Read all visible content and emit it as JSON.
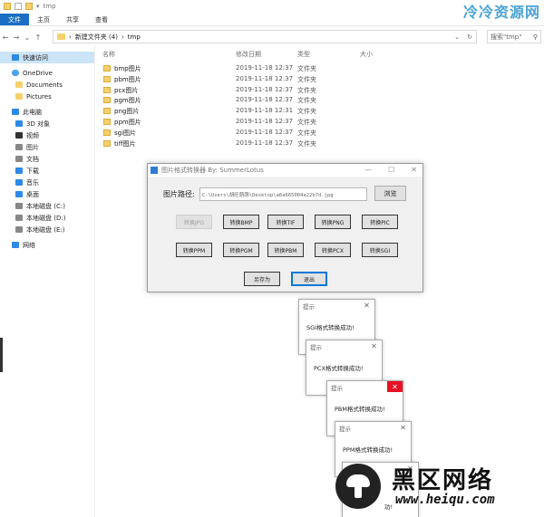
{
  "explorer": {
    "title": "tmp",
    "ribbon_tabs": [
      "文件",
      "主页",
      "共享",
      "查看"
    ],
    "address": [
      "新建文件夹 (4)",
      "tmp"
    ],
    "search_placeholder": "搜索\"tmp\"",
    "sidebar": [
      {
        "label": "快速访问",
        "icon": "star-icon"
      },
      {
        "label": "OneDrive",
        "icon": "cloud-icon"
      },
      {
        "label": "Documents",
        "icon": "folder-icon"
      },
      {
        "label": "Pictures",
        "icon": "folder-icon"
      },
      {
        "label": "此电脑",
        "icon": "computer-icon"
      },
      {
        "label": "3D 对象",
        "icon": "cube-icon"
      },
      {
        "label": "视频",
        "icon": "video-icon"
      },
      {
        "label": "图片",
        "icon": "picture-icon"
      },
      {
        "label": "文档",
        "icon": "document-icon"
      },
      {
        "label": "下载",
        "icon": "download-icon"
      },
      {
        "label": "音乐",
        "icon": "music-icon"
      },
      {
        "label": "桌面",
        "icon": "desktop-icon"
      },
      {
        "label": "本地磁盘 (C:)",
        "icon": "drive-icon"
      },
      {
        "label": "本地磁盘 (D:)",
        "icon": "drive-icon"
      },
      {
        "label": "本地磁盘 (E:)",
        "icon": "drive-icon"
      },
      {
        "label": "网络",
        "icon": "network-icon"
      }
    ],
    "columns": {
      "name": "名称",
      "date": "修改日期",
      "type": "类型",
      "size": "大小"
    },
    "files": [
      {
        "name": "bmp图片",
        "date": "2019-11-18 12:37",
        "type": "文件夹"
      },
      {
        "name": "pbm图片",
        "date": "2019-11-18 12:37",
        "type": "文件夹"
      },
      {
        "name": "pcx图片",
        "date": "2019-11-18 12:37",
        "type": "文件夹"
      },
      {
        "name": "pgm图片",
        "date": "2019-11-18 12:37",
        "type": "文件夹"
      },
      {
        "name": "png图片",
        "date": "2019-11-18 12:31",
        "type": "文件夹"
      },
      {
        "name": "ppm图片",
        "date": "2019-11-18 12:37",
        "type": "文件夹"
      },
      {
        "name": "sgi图片",
        "date": "2019-11-18 12:37",
        "type": "文件夹"
      },
      {
        "name": "tiff图片",
        "date": "2019-11-18 12:37",
        "type": "文件夹"
      }
    ]
  },
  "converter": {
    "title": "图片格式转换器 By: SummerLotus",
    "path_label": "图片路径:",
    "path_value": "C:\\Users\\胡旺荫荫\\Desktop\\a6a665004a22b7d.jpg",
    "browse_label": "浏览",
    "buttons_row1": [
      "转换JPG",
      "转换BMP",
      "转换TIF",
      "转换PNG",
      "转换PIC"
    ],
    "buttons_row2": [
      "转换PPM",
      "转换PGM",
      "转换PBM",
      "转换PCX",
      "转换SGI"
    ],
    "save_label": "另存为",
    "exit_label": "退出"
  },
  "messages": [
    {
      "title": "提示",
      "text": "SGI格式转换成功!"
    },
    {
      "title": "提示",
      "text": "PCX格式转换成功!"
    },
    {
      "title": "提示",
      "text": "PBM格式转换成功!"
    },
    {
      "title": "提示",
      "text": "PPM格式转换成功!"
    },
    {
      "title": "",
      "text": "功!"
    }
  ],
  "watermarks": {
    "top": "冷冷资源网",
    "bottom_title": "黑区网络",
    "bottom_url": "www.heiqu.com"
  },
  "colors": {
    "file_tab": "#1a6fc4",
    "selection": "#cce4f7",
    "close_hover": "#e81123",
    "focus_border": "#0078d7"
  }
}
